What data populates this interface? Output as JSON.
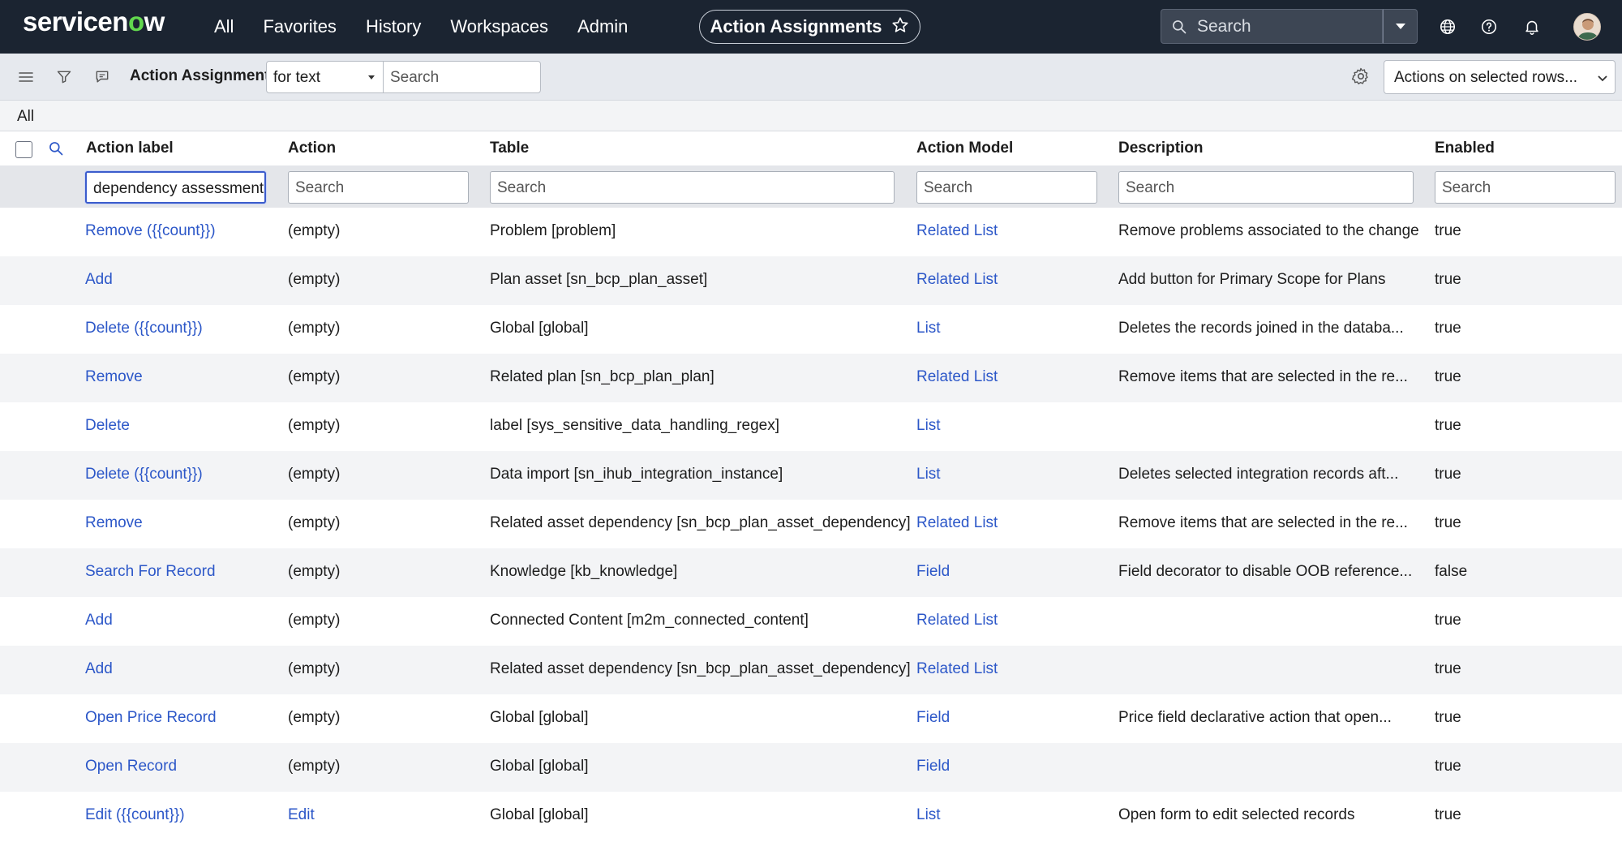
{
  "nav": {
    "logo": {
      "before": "servicen",
      "o": "o",
      "after": "w"
    },
    "links": [
      "All",
      "Favorites",
      "History",
      "Workspaces",
      "Admin"
    ],
    "context_title": "Action Assignments",
    "search_placeholder": "Search"
  },
  "listbar": {
    "title": "Action Assignments",
    "filter_select": "for text",
    "search_placeholder": "Search",
    "actions_select": "Actions on selected rows..."
  },
  "breadcrumb": "All",
  "columns": [
    "Action label",
    "Action",
    "Table",
    "Action Model",
    "Description",
    "Enabled"
  ],
  "filters": {
    "action_label": "dependency assessment",
    "action": "Search",
    "table": "Search",
    "action_model": "Search",
    "description": "Search",
    "enabled": "Search"
  },
  "rows": [
    {
      "label": "Remove ({{count}})",
      "action": "(empty)",
      "table": "Problem [problem]",
      "model": "Related List",
      "description": "Remove problems associated to the change",
      "enabled": "true"
    },
    {
      "label": "Add",
      "action": "(empty)",
      "table": "Plan asset [sn_bcp_plan_asset]",
      "model": "Related List",
      "description": "Add button for Primary Scope for Plans",
      "enabled": "true"
    },
    {
      "label": "Delete ({{count}})",
      "action": "(empty)",
      "table": "Global [global]",
      "model": "List",
      "description": "Deletes the records joined in the databa...",
      "enabled": "true"
    },
    {
      "label": "Remove",
      "action": "(empty)",
      "table": "Related plan [sn_bcp_plan_plan]",
      "model": "Related List",
      "description": "Remove items that are selected in the re...",
      "enabled": "true"
    },
    {
      "label": "Delete",
      "action": "(empty)",
      "table": "label [sys_sensitive_data_handling_regex]",
      "model": "List",
      "description": "",
      "enabled": "true"
    },
    {
      "label": "Delete ({{count}})",
      "action": "(empty)",
      "table": "Data import [sn_ihub_integration_instance]",
      "model": "List",
      "description": "Deletes selected integration records aft...",
      "enabled": "true"
    },
    {
      "label": "Remove",
      "action": "(empty)",
      "table": "Related asset dependency [sn_bcp_plan_asset_dependency]",
      "model": "Related List",
      "description": "Remove items that are selected in the re...",
      "enabled": "true"
    },
    {
      "label": "Search For Record",
      "action": "(empty)",
      "table": "Knowledge [kb_knowledge]",
      "model": "Field",
      "description": "Field decorator to disable OOB reference...",
      "enabled": "false"
    },
    {
      "label": "Add",
      "action": "(empty)",
      "table": "Connected Content [m2m_connected_content]",
      "model": "Related List",
      "description": "",
      "enabled": "true"
    },
    {
      "label": "Add",
      "action": "(empty)",
      "table": "Related asset dependency [sn_bcp_plan_asset_dependency]",
      "model": "Related List",
      "description": "",
      "enabled": "true"
    },
    {
      "label": "Open Price Record",
      "action": "(empty)",
      "table": "Global [global]",
      "model": "Field",
      "description": "Price field declarative action that open...",
      "enabled": "true"
    },
    {
      "label": "Open Record",
      "action": "(empty)",
      "table": "Global [global]",
      "model": "Field",
      "description": "",
      "enabled": "true"
    },
    {
      "label": "Edit ({{count}})",
      "action": "Edit",
      "action_is_link": true,
      "table": "Global [global]",
      "model": "List",
      "description": "Open form to edit selected records",
      "enabled": "true"
    }
  ],
  "colors": {
    "nav_bg": "#1b2431",
    "link": "#2c57c8",
    "logo_accent": "#62d84e"
  }
}
